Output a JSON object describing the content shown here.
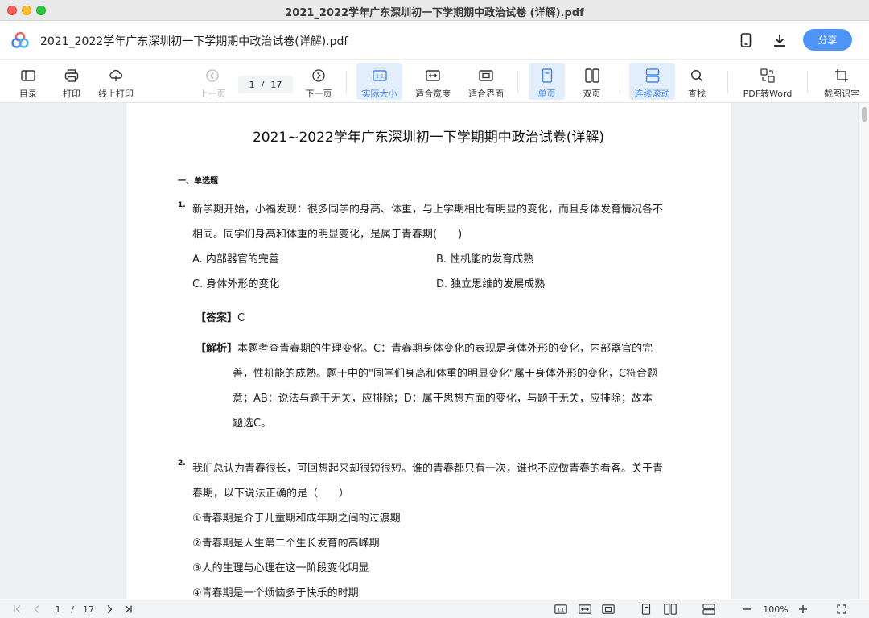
{
  "window": {
    "title": "2021_2022学年广东深圳初一下学期期中政治试卷 (详解).pdf"
  },
  "header": {
    "doc_title": "2021_2022学年广东深圳初一下学期期中政治试卷(详解).pdf",
    "share_label": "分享"
  },
  "toolbar": {
    "toc": "目录",
    "print": "打印",
    "online_print": "线上打印",
    "prev_page": "上一页",
    "current_page": "1",
    "page_sep": "/",
    "total_pages": "17",
    "next_page": "下一页",
    "actual_size": "实际大小",
    "fit_width": "适合宽度",
    "fit_page": "适合界面",
    "single_page": "单页",
    "double_page": "双页",
    "continuous": "连续滚动",
    "find": "查找",
    "pdf_to_word": "PDF转Word",
    "ocr": "截图识字"
  },
  "document": {
    "heading": "2021~2022学年广东深圳初一下学期期中政治试卷(详解)",
    "section": "一、单选题",
    "q1": {
      "num": "1.",
      "line1": "新学期开始，小福发现：很多同学的身高、体重，与上学期相比有明显的变化，而且身体发育情况各不",
      "line2": "相同。同学们身高和体重的明显变化，是属于青春期(　　)",
      "opt_a": "A. 内部器官的完善",
      "opt_b": "B. 性机能的发育成熟",
      "opt_c": "C. 身体外形的变化",
      "opt_d": "D. 独立思维的发展成熟",
      "answer_label": "【答案】",
      "answer": "C",
      "analysis_label": "【解析】",
      "analysis1": "本题考查青春期的生理变化。C：青春期身体变化的表现是身体外形的变化，内部器官的完",
      "analysis2": "善，性机能的成熟。题干中的\"同学们身高和体重的明显变化\"属于身体外形的变化，C符合题",
      "analysis3": "意；AB：说法与题干无关，应排除；D：属于思想方面的变化，与题干无关，应排除；故本",
      "analysis4": "题选C。"
    },
    "q2": {
      "num": "2.",
      "line1": "我们总认为青春很长，可回想起来却很短很短。谁的青春都只有一次，谁也不应做青春的看客。关于青",
      "line2": "春期，以下说法正确的是（　　）",
      "s1": "①青春期是介于儿童期和成年期之间的过渡期",
      "s2": "②青春期是人生第二个生长发育的高峰期",
      "s3": "③人的生理与心理在这一阶段变化明显",
      "s4": "④青春期是一个烦恼多于快乐的时期"
    }
  },
  "statusbar": {
    "current_page": "1",
    "page_sep": "/",
    "total_pages": "17",
    "zoom": "100%"
  },
  "colors": {
    "accent": "#4e93f8",
    "active_bg": "#e3eefc",
    "active_text": "#3f85f1"
  }
}
